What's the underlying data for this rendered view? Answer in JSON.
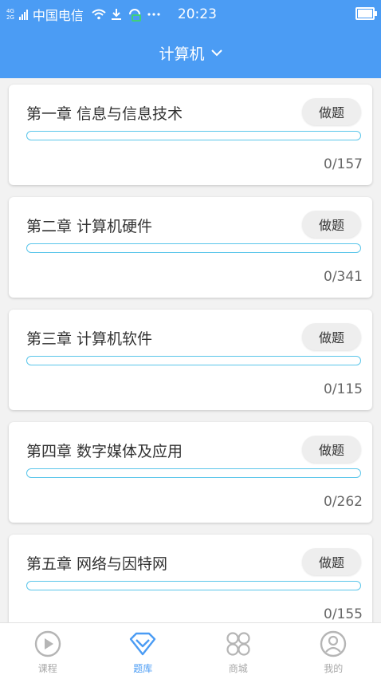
{
  "status_bar": {
    "network_top": "4G",
    "network_bottom": "2G",
    "carrier": "中国电信",
    "time": "20:23"
  },
  "header": {
    "title": "计算机",
    "dropdown_icon": "chevron-down-icon"
  },
  "chapters": [
    {
      "title": "第一章 信息与信息技术",
      "button_label": "做题",
      "progress_text": "0/157",
      "progress_fraction": 0
    },
    {
      "title": "第二章 计算机硬件",
      "button_label": "做题",
      "progress_text": "0/341",
      "progress_fraction": 0
    },
    {
      "title": "第三章 计算机软件",
      "button_label": "做题",
      "progress_text": "0/115",
      "progress_fraction": 0
    },
    {
      "title": "第四章 数字媒体及应用",
      "button_label": "做题",
      "progress_text": "0/262",
      "progress_fraction": 0
    },
    {
      "title": "第五章 网络与因特网",
      "button_label": "做题",
      "progress_text": "0/155",
      "progress_fraction": 0
    }
  ],
  "tabs": [
    {
      "label": "课程",
      "icon": "play-circle-icon",
      "active": false
    },
    {
      "label": "题库",
      "icon": "diamond-icon",
      "active": true
    },
    {
      "label": "商城",
      "icon": "grid-icon",
      "active": false
    },
    {
      "label": "我的",
      "icon": "user-icon",
      "active": false
    }
  ],
  "colors": {
    "header": "#4b9cf4",
    "accent": "#4b9cf4",
    "progress": "#5bc6ea",
    "inactive_tab": "#a8a8a8"
  }
}
